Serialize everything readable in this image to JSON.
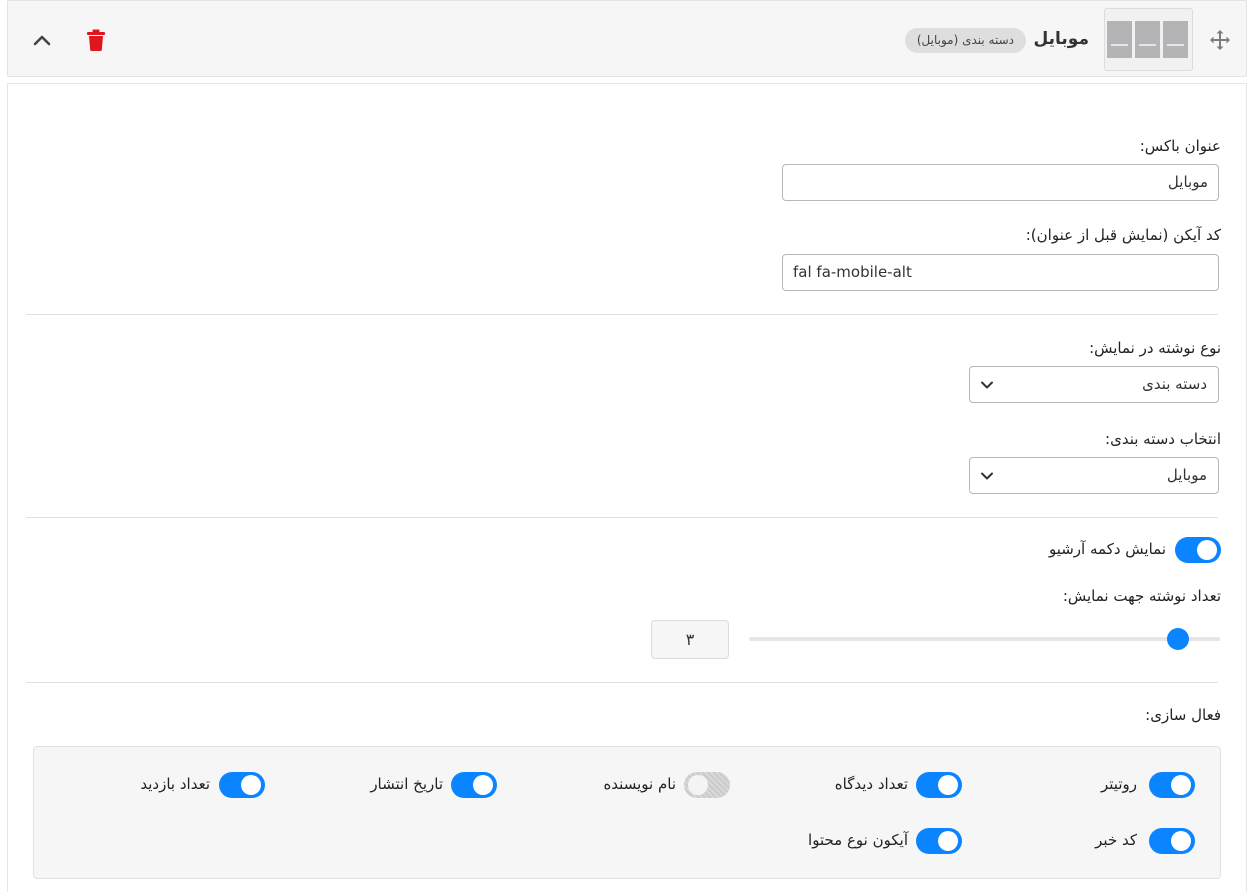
{
  "header": {
    "title": "موبایل",
    "badge": "دسته بندی (موبایل)"
  },
  "form": {
    "box_title": {
      "label": "عنوان باکس:",
      "value": "موبایل"
    },
    "icon_code": {
      "label": "کد آیکن (نمایش قبل از عنوان):",
      "value": "fal fa-mobile-alt"
    },
    "post_type": {
      "label": "نوع نوشته در نمایش:",
      "selected": "دسته بندی"
    },
    "category": {
      "label": "انتخاب دسته بندی:",
      "selected": "موبایل"
    },
    "archive_toggle": {
      "label": "نمایش دکمه آرشیو",
      "on": true
    },
    "post_count": {
      "label": "تعداد نوشته جهت نمایش:",
      "value": "۳",
      "slider_fraction": 0.91
    },
    "activation": {
      "label": "فعال سازی:",
      "options": [
        {
          "label": "روتیتر",
          "on": true
        },
        {
          "label": "تعداد دیدگاه",
          "on": true
        },
        {
          "label": "نام نویسنده",
          "on": false
        },
        {
          "label": "تاریخ انتشار",
          "on": true
        },
        {
          "label": "تعداد بازدید",
          "on": true
        },
        {
          "label": "کد خبر",
          "on": true
        },
        {
          "label": "آیکون نوع محتوا",
          "on": true
        }
      ]
    }
  },
  "colors": {
    "accent": "#0a84ff",
    "delete": "#e0161e",
    "toggle_off": "#d4d4d4"
  },
  "icons": {
    "move": "move-arrows-icon",
    "layout": "three-column-layout-icon",
    "delete": "trash-icon",
    "collapse": "chevron-up-icon",
    "dropdown": "chevron-down-icon"
  }
}
